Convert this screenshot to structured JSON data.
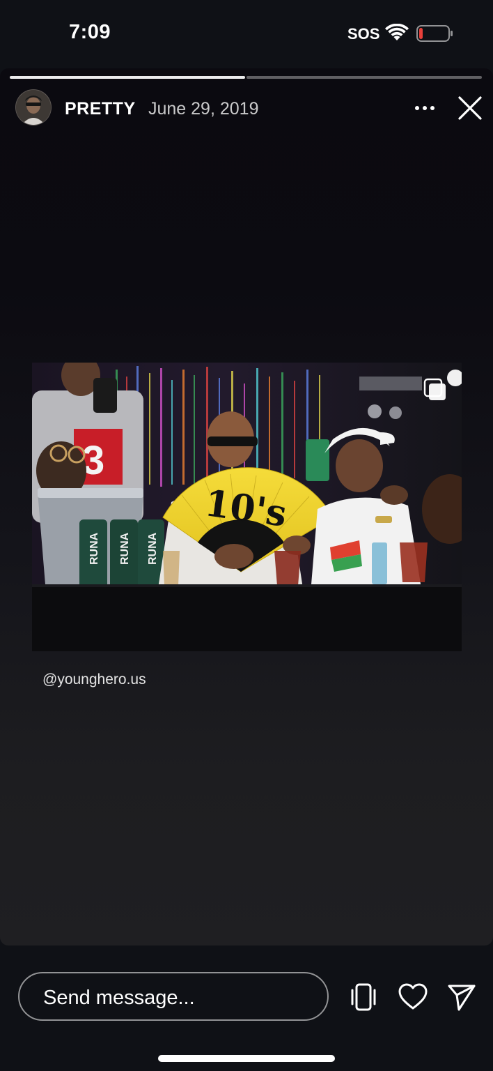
{
  "status_bar": {
    "time": "7:09",
    "carrier": "SOS",
    "wifi_icon": "wifi-icon",
    "battery_icon": "battery-low-icon",
    "battery_color": "#e8403a"
  },
  "story": {
    "progress": {
      "segments_total": 2,
      "current_segment": 2,
      "current_segment_progress": 0
    },
    "author": {
      "username": "PRETTY",
      "avatar_icon": "avatar"
    },
    "date": "June 29, 2019",
    "more_icon": "more-horizontal-icon",
    "close_icon": "close-icon",
    "photo": {
      "fan_text": "10's",
      "can_brand": "RUNA",
      "multi_image_icon": "copy-icon"
    },
    "caption": "@younghero.us"
  },
  "footer": {
    "message_placeholder": "Send message...",
    "phone_icon": "phone-vibrate-icon",
    "like_icon": "heart-icon",
    "share_icon": "send-icon"
  },
  "colors": {
    "background": "#0f1116",
    "fan_yellow": "#f2d22e",
    "can_green": "#1f4a3c"
  }
}
